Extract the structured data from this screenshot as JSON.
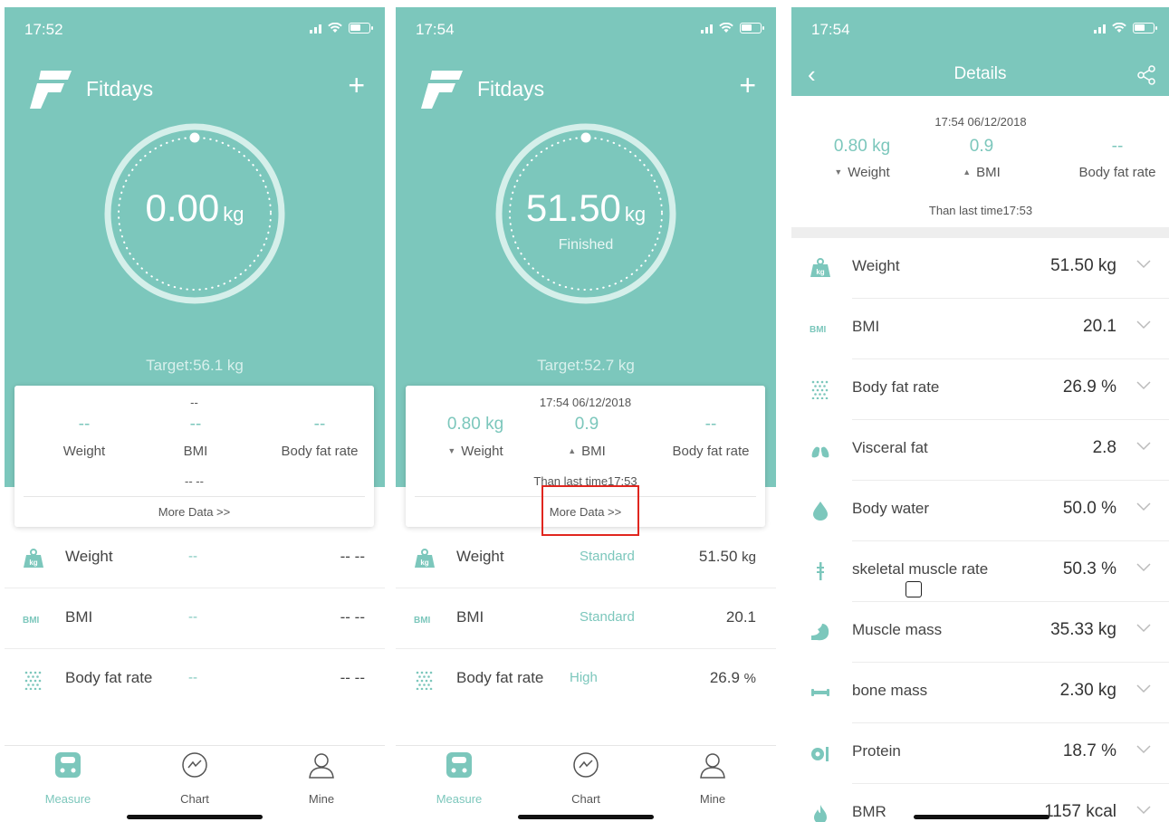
{
  "screens": [
    {
      "status": {
        "time": "17:52"
      },
      "app_name": "Fitdays",
      "add_label": "+",
      "weight_value": "0.00",
      "weight_unit": "kg",
      "status_text": "",
      "target": "Target:56.1 kg",
      "card": {
        "date": "--",
        "cols": [
          {
            "value": "--",
            "label": "Weight"
          },
          {
            "value": "--",
            "label": "BMI"
          },
          {
            "value": "--",
            "label": "Body fat rate"
          }
        ],
        "than_last": "-- --",
        "more": "More Data >>"
      },
      "rows": [
        {
          "name": "Weight",
          "status": "--",
          "value": "-- --",
          "unit": "",
          "icon": "kg-weight-icon"
        },
        {
          "name": "BMI",
          "status": "--",
          "value": "-- --",
          "unit": "",
          "icon": "bmi-icon"
        },
        {
          "name": "Body fat rate",
          "status": "--",
          "value": "-- --",
          "unit": "",
          "icon": "body-fat-icon"
        }
      ],
      "tabs": [
        {
          "label": "Measure",
          "active": true
        },
        {
          "label": "Chart",
          "active": false
        },
        {
          "label": "Mine",
          "active": false
        }
      ]
    },
    {
      "status": {
        "time": "17:54"
      },
      "app_name": "Fitdays",
      "add_label": "+",
      "weight_value": "51.50",
      "weight_unit": "kg",
      "status_text": "Finished",
      "target": "Target:52.7 kg",
      "card": {
        "date": "17:54 06/12/2018",
        "cols": [
          {
            "value": "0.80 kg",
            "label": "Weight",
            "trend": "down"
          },
          {
            "value": "0.9",
            "label": "BMI",
            "trend": "up"
          },
          {
            "value": "--",
            "label": "Body fat rate"
          }
        ],
        "than_last": "Than last time17:53",
        "more": "More Data >>"
      },
      "rows": [
        {
          "name": "Weight",
          "status": "Standard",
          "value": "51.50",
          "unit": "kg",
          "icon": "kg-weight-icon"
        },
        {
          "name": "BMI",
          "status": "Standard",
          "value": "20.1",
          "unit": "",
          "icon": "bmi-icon"
        },
        {
          "name": "Body fat rate",
          "status": "High",
          "value": "26.9",
          "unit": "%",
          "icon": "body-fat-icon"
        }
      ],
      "tabs": [
        {
          "label": "Measure",
          "active": true
        },
        {
          "label": "Chart",
          "active": false
        },
        {
          "label": "Mine",
          "active": false
        }
      ]
    }
  ],
  "details": {
    "status": {
      "time": "17:54"
    },
    "title": "Details",
    "back": "‹",
    "date": "17:54 06/12/2018",
    "cols": [
      {
        "value": "0.80 kg",
        "label": "Weight",
        "trend": "down"
      },
      {
        "value": "0.9",
        "label": "BMI",
        "trend": "up"
      },
      {
        "value": "--",
        "label": "Body fat rate"
      }
    ],
    "than_last": "Than last time17:53",
    "items": [
      {
        "name": "Weight",
        "value": "51.50 kg",
        "icon": "kg-weight-icon"
      },
      {
        "name": "BMI",
        "value": "20.1",
        "icon": "bmi-icon"
      },
      {
        "name": "Body fat rate",
        "value": "26.9 %",
        "icon": "body-fat-icon"
      },
      {
        "name": "Visceral fat",
        "value": "2.8",
        "icon": "lungs-icon"
      },
      {
        "name": "Body water",
        "value": "50.0 %",
        "icon": "water-drop-icon"
      },
      {
        "name": "skeletal muscle rate",
        "value": "50.3 %",
        "icon": "skeleton-icon"
      },
      {
        "name": "Muscle mass",
        "value": "35.33 kg",
        "icon": "muscle-arm-icon"
      },
      {
        "name": "bone mass",
        "value": "2.30 kg",
        "icon": "bone-icon"
      },
      {
        "name": "Protein",
        "value": "18.7 %",
        "icon": "protein-icon"
      },
      {
        "name": "BMR",
        "value": "1157 kcal",
        "icon": "flame-icon"
      }
    ]
  },
  "colors": {
    "accent": "#7cc7bc",
    "highlight_box": "#e0261f",
    "text": "#444444"
  }
}
